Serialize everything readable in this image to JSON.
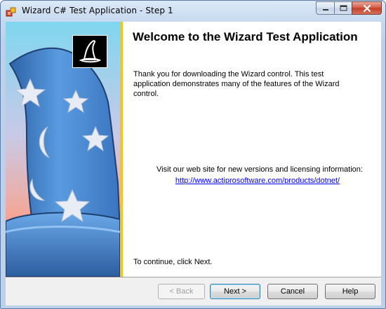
{
  "window": {
    "title": "Wizard C# Test Application - Step 1"
  },
  "page": {
    "heading": "Welcome to the Wizard Test Application",
    "intro": "Thank you for downloading the Wizard control.  This test application demonstrates many of the features of the Wizard control.",
    "visit_text": "Visit our web site for new versions and licensing information:",
    "link_text": "http://www.actiprosoftware.com/products/dotnet/",
    "continue_text": "To continue, click Next."
  },
  "buttons": {
    "back": "< Back",
    "next": "Next >",
    "cancel": "Cancel",
    "help": "Help"
  },
  "icons": {
    "app": "wizard-app-icon",
    "minimize": "minimize-icon",
    "maximize": "maximize-icon",
    "close": "close-icon",
    "wizard_hat": "wizard-hat-icon",
    "banner": "wizard-hat-illustration"
  },
  "colors": {
    "divider": "#f4c51f",
    "link": "#0000ff",
    "hat_blue": "#4c8fd3",
    "banner_top": "#7fd6f0",
    "banner_bottom": "#f08060"
  }
}
